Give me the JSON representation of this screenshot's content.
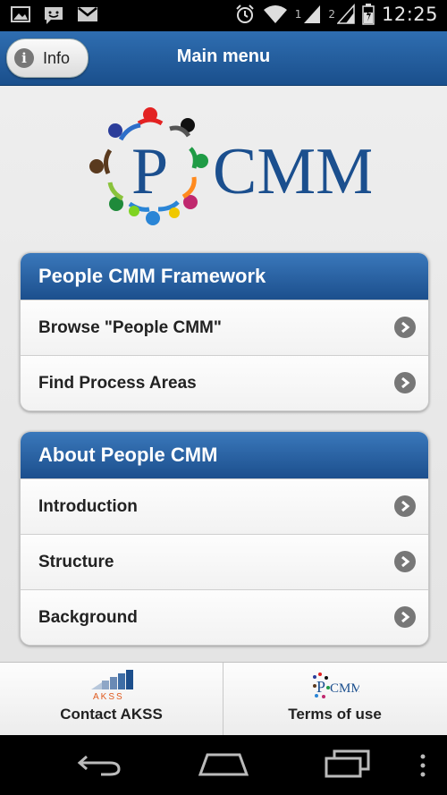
{
  "status_bar": {
    "time": "12:25",
    "sim1": "1",
    "sim2": "2",
    "icons": [
      "picture-icon",
      "chat-icon",
      "gmail-icon",
      "alarm-icon",
      "wifi-icon",
      "signal-icon",
      "battery-icon"
    ]
  },
  "header": {
    "title": "Main menu",
    "info_label": "Info",
    "info_glyph": "i"
  },
  "logo": {
    "letter": "P",
    "text": "CMM"
  },
  "sections": [
    {
      "title": "People CMM Framework",
      "items": [
        "Browse \"People CMM\"",
        "Find Process Areas"
      ]
    },
    {
      "title": "About People CMM",
      "items": [
        "Introduction",
        "Structure",
        "Background"
      ]
    }
  ],
  "footer": {
    "left_label": "Contact AKSS",
    "left_logo_text": "AKSS",
    "right_label": "Terms of use",
    "right_logo_letter": "P",
    "right_logo_text": "CMM"
  },
  "colors": {
    "header_blue": "#1a4f8c",
    "logo_blue": "#1b4f8e",
    "arrow_grey": "#777777"
  }
}
